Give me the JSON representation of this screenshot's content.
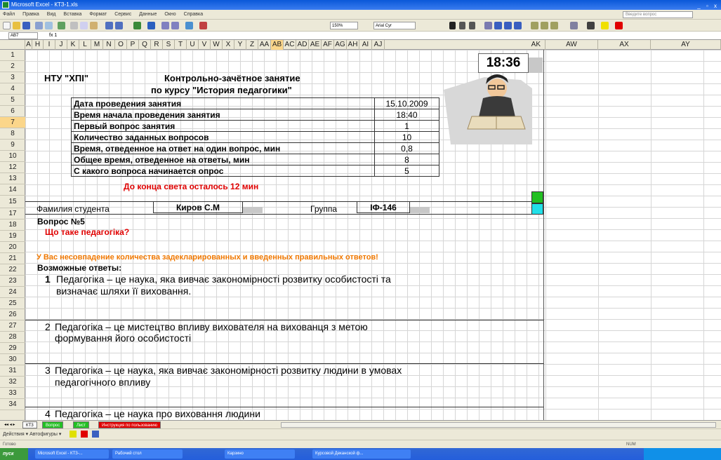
{
  "window": {
    "title": "Microsoft Excel - КТЗ-1.xls",
    "controls": "_ ▫ x"
  },
  "menu": {
    "items": [
      "Файл",
      "Правка",
      "Вид",
      "Вставка",
      "Формат",
      "Сервис",
      "Данные",
      "Окно",
      "Справка"
    ],
    "help_placeholder": "Введите вопрос"
  },
  "toolbar": {
    "zoom": "150%",
    "font": "Arial Cyr"
  },
  "formula_bar": {
    "name_box": "AB7",
    "fx": "fx 1"
  },
  "columns": [
    "A",
    "H",
    "I",
    "J",
    "K",
    "L",
    "M",
    "N",
    "O",
    "P",
    "Q",
    "R",
    "S",
    "T",
    "U",
    "V",
    "W",
    "X",
    "Y",
    "Z",
    "AA",
    "AB",
    "AC",
    "AD",
    "AE",
    "AF",
    "AG",
    "AH",
    "AI",
    "AJ",
    "AK",
    "AW",
    "AX",
    "AY"
  ],
  "rows": [
    "1",
    "2",
    "3",
    "4",
    "5",
    "6",
    "7",
    "8",
    "9",
    "10",
    "12",
    "13",
    "14",
    "15",
    "17",
    "18",
    "19",
    "20",
    "21",
    "22",
    "23",
    "24",
    "25",
    "26",
    "27",
    "28",
    "29",
    "30",
    "31",
    "32",
    "33",
    "34"
  ],
  "clock": "18:36",
  "header": {
    "university": "НТУ \"ХПІ\"",
    "title_line1": "Контрольно-зачётное занятие",
    "title_line2": "по курсу \"История педагогики\""
  },
  "info": [
    {
      "label": "Дата проведения занятия",
      "value": "15.10.2009"
    },
    {
      "label": "Время начала проведения занятия",
      "value": "18:40"
    },
    {
      "label": "Первый вопрос занятия",
      "value": "1"
    },
    {
      "label": "Количество заданных вопросов",
      "value": "10"
    },
    {
      "label": "Время, отведенное на ответ на один вопрос, мин",
      "value": "0,8"
    },
    {
      "label": "Общее время, отведенное на ответы, мин",
      "value": "8"
    },
    {
      "label": "С какого вопроса начинается опрос",
      "value": "5"
    }
  ],
  "countdown": "До конца света осталось 12 мин",
  "student": {
    "surname_label": "Фамилия студента",
    "surname_value": "Киров С.М",
    "group_label": "Группа",
    "group_value": "ІФ-146"
  },
  "question": {
    "number": "Вопрос №5",
    "text": "Що таке педагогіка?",
    "warning": "У Вас несовпадение количества задекларированных и введенных правильных ответов!",
    "answers_label": "Возможные ответы:"
  },
  "answers": [
    {
      "num": "1",
      "line1": "Педагогіка – це наука, яка вивчає закономірності розвитку особистості та",
      "line2": "визначає  шляхи її виховання."
    },
    {
      "num": "2",
      "line1": "Педагогіка – це мистецтво впливу вихователя на вихованця з метою",
      "line2": "формування його особистості"
    },
    {
      "num": "3",
      "line1": "Педагогіка – це наука, яка вивчає закономірності розвитку людини в умовах",
      "line2": "педагогічного впливу"
    },
    {
      "num": "4",
      "line1": "Педагогіка – це наука про виховання людини",
      "line2": ""
    }
  ],
  "sheet_tabs": [
    "КТЗ",
    "Вопрос",
    "Лист",
    "Инструкция по пользованию"
  ],
  "draw_toolbar": "Действия ▾   Автофигуры ▾",
  "status": "Готово",
  "status_right": "NUM",
  "taskbar": {
    "start": "пуск",
    "buttons": [
      "Microsoft Excel - КТЗ-...",
      "Рабочий стол",
      "Карзино",
      "Курсовой Деканской ф..."
    ]
  },
  "colors": {
    "accent_red": "#e00000",
    "warning_orange": "#f07800",
    "selected_header": "#fbd68a",
    "green_cell": "#22c022",
    "cyan_cell": "#22e0e8"
  }
}
